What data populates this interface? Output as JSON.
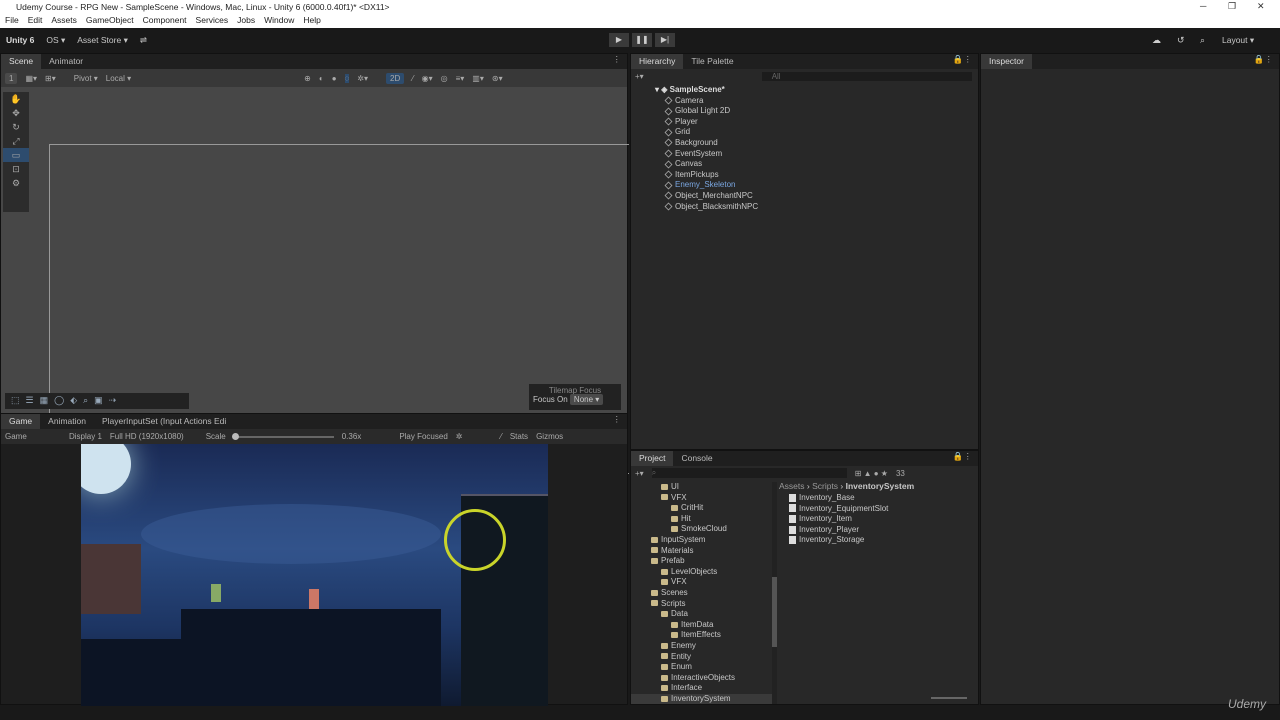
{
  "window": {
    "title": "Udemy Course - RPG New - SampleScene - Windows, Mac, Linux - Unity 6 (6000.0.40f1)* <DX11>",
    "minimize": "─",
    "maximize": "❐",
    "close": "✕"
  },
  "menu": [
    "File",
    "Edit",
    "Assets",
    "GameObject",
    "Component",
    "Services",
    "Jobs",
    "Window",
    "Help"
  ],
  "toolbar": {
    "account": "Unity 6",
    "os": "OS ▾",
    "asset_store": "Asset Store ▾",
    "play": "▶",
    "pause": "❚❚",
    "step": "▶|",
    "layout": "Layout ▾"
  },
  "scene": {
    "tabs": [
      "Scene",
      "Animator"
    ],
    "layer": "1",
    "pivot": "Pivot ▾",
    "local": "Local ▾",
    "mode2d": "2D",
    "tilemap_focus": "Tilemap Focus",
    "focus_on": "Focus On",
    "focus_value": "None ▾"
  },
  "game": {
    "tabs": [
      "Game",
      "Animation",
      "PlayerInputSet (Input Actions Edi"
    ],
    "view": "Game",
    "display": "Display 1",
    "resolution": "Full HD (1920x1080)",
    "scale_label": "Scale",
    "scale_value": "0.36x",
    "scale_fraction": 0.0,
    "play_focused": "Play Focused",
    "stats": "Stats",
    "gizmos": "Gizmos"
  },
  "hierarchy": {
    "tabs": [
      "Hierarchy",
      "Tile Palette"
    ],
    "search_placeholder": "All",
    "scene": "SampleScene*",
    "items": [
      "Camera",
      "Global Light 2D",
      "Player",
      "Grid",
      "Background",
      "EventSystem",
      "Canvas",
      "ItemPickups",
      "Enemy_Skeleton",
      "Object_MerchantNPC",
      "Object_BlacksmithNPC"
    ]
  },
  "inspector": {
    "tab": "Inspector"
  },
  "project": {
    "tabs": [
      "Project",
      "Console"
    ],
    "count": "33",
    "breadcrumb": [
      "Assets",
      "Scripts",
      "InventorySystem"
    ],
    "tree": [
      {
        "l": "UI",
        "d": 1
      },
      {
        "l": "VFX",
        "d": 1
      },
      {
        "l": "CritHit",
        "d": 2
      },
      {
        "l": "Hit",
        "d": 2
      },
      {
        "l": "SmokeCloud",
        "d": 2
      },
      {
        "l": "InputSystem",
        "d": 0
      },
      {
        "l": "Materials",
        "d": 0
      },
      {
        "l": "Prefab",
        "d": 0
      },
      {
        "l": "LevelObjects",
        "d": 1
      },
      {
        "l": "VFX",
        "d": 1
      },
      {
        "l": "Scenes",
        "d": 0
      },
      {
        "l": "Scripts",
        "d": 0
      },
      {
        "l": "Data",
        "d": 1
      },
      {
        "l": "ItemData",
        "d": 2
      },
      {
        "l": "ItemEffects",
        "d": 2
      },
      {
        "l": "Enemy",
        "d": 1
      },
      {
        "l": "Entity",
        "d": 1
      },
      {
        "l": "Enum",
        "d": 1
      },
      {
        "l": "InteractiveObjects",
        "d": 1
      },
      {
        "l": "Interface",
        "d": 1
      },
      {
        "l": "InventorySystem",
        "d": 1
      }
    ],
    "files": [
      "Inventory_Base",
      "Inventory_EquipmentSlot",
      "Inventory_Item",
      "Inventory_Player",
      "Inventory_Storage"
    ]
  },
  "watermark": "Udemy"
}
